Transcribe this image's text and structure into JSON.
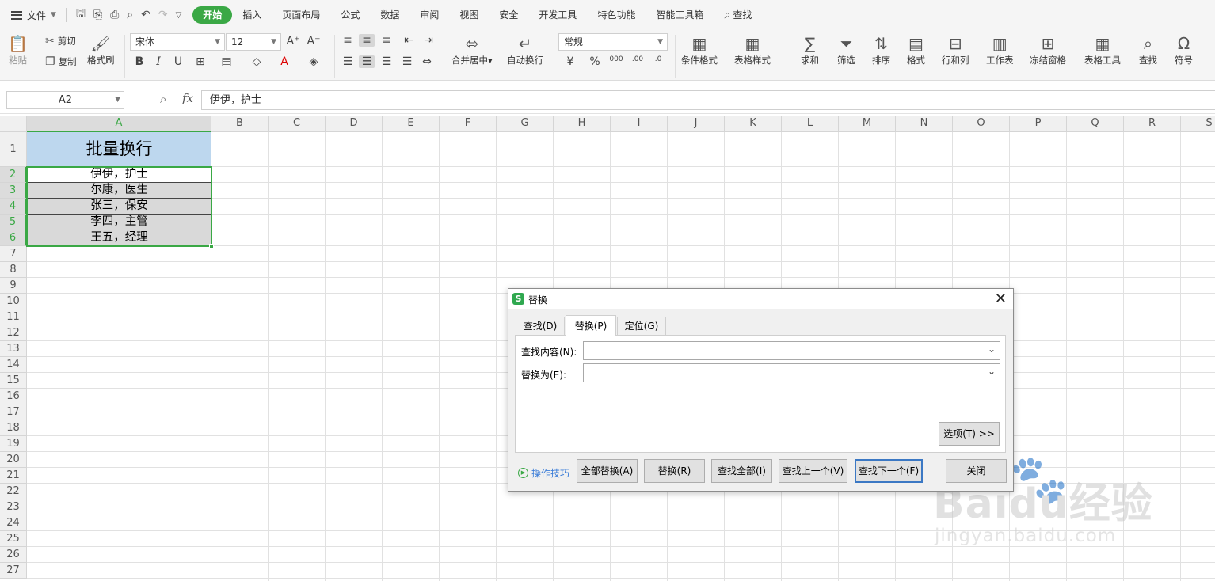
{
  "menubar": {
    "file_label": "文件",
    "tabs": [
      "开始",
      "插入",
      "页面布局",
      "公式",
      "数据",
      "审阅",
      "视图",
      "安全",
      "开发工具",
      "特色功能",
      "智能工具箱"
    ],
    "search_label": "查找"
  },
  "ribbon": {
    "paste": "粘贴",
    "cut": "剪切",
    "copy": "复制",
    "format_painter": "格式刷",
    "font_name": "宋体",
    "font_size": "12",
    "merge_center": "合并居中",
    "wrap_text": "自动换行",
    "number_format": "常规",
    "conditional_format": "条件格式",
    "table_style": "表格样式",
    "sum": "求和",
    "filter": "筛选",
    "sort": "排序",
    "format": "格式",
    "row_col": "行和列",
    "worksheet": "工作表",
    "freeze": "冻结窗格",
    "table_tools": "表格工具",
    "find": "查找",
    "symbol": "符号"
  },
  "formula_bar": {
    "name_box": "A2",
    "fx": "fx",
    "content": "伊伊，护士"
  },
  "sheet": {
    "columns": [
      "A",
      "B",
      "C",
      "D",
      "E",
      "F",
      "G",
      "H",
      "I",
      "J",
      "K",
      "L",
      "M",
      "N",
      "O",
      "P",
      "Q",
      "R",
      "S"
    ],
    "rows": [
      "1",
      "2",
      "3",
      "4",
      "5",
      "6",
      "7",
      "8",
      "9",
      "10",
      "11",
      "12",
      "13",
      "14",
      "15",
      "16",
      "17",
      "18",
      "19",
      "20",
      "21",
      "22",
      "23",
      "24",
      "25",
      "26",
      "27"
    ],
    "header_cell": "批量换行",
    "data_cells": [
      "伊伊，护士",
      "尔康，医生",
      "张三，保安",
      "李四，主管",
      "王五，经理"
    ]
  },
  "dialog": {
    "title": "替换",
    "tabs": [
      "查找(D)",
      "替换(P)",
      "定位(G)"
    ],
    "find_label": "查找内容(N):",
    "find_value": "",
    "replace_label": "替换为(E):",
    "replace_value": "",
    "options_button": "选项(T) >>",
    "tips": "操作技巧",
    "buttons": [
      "全部替换(A)",
      "替换(R)",
      "查找全部(I)",
      "查找上一个(V)",
      "查找下一个(F)",
      "关闭"
    ]
  },
  "watermark": {
    "text": "Baidu经验",
    "url": "jingyan.baidu.com"
  },
  "colors": {
    "accent": "#3aa845",
    "header_fill": "#bdd7ee",
    "data_fill": "#d9d9d9",
    "primary_button_border": "#3b78c4"
  }
}
